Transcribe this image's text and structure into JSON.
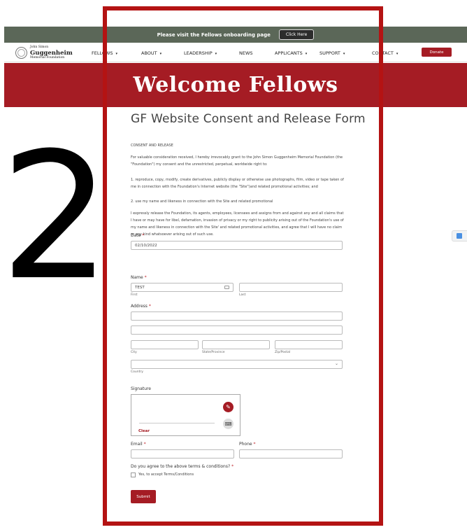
{
  "announcement": {
    "message": "Please visit the Fellows onboarding page",
    "button": "Click Here"
  },
  "logo": {
    "line1": "John Simon",
    "line2": "Guggenheim",
    "line3": "Memorial Foundation"
  },
  "nav": {
    "items": [
      "FELLOWS",
      "ABOUT",
      "LEADERSHIP",
      "NEWS",
      "APPLICANTS",
      "SUPPORT",
      "CONTACT"
    ],
    "chevron": "▾",
    "donate": "Donate"
  },
  "hero": {
    "title": "Welcome Fellows"
  },
  "overlay_number": "2",
  "form": {
    "title": "GF Website Consent and Release Form",
    "section_heading": "CONSENT AND RELEASE",
    "intro": "For valuable consideration received, I hereby irrevocably grant to the John Simon Guggenheim Memorial Foundation (the \"Foundation\") my consent and the unrestricted, perpetual, worldwide right to:",
    "list": [
      "1. reproduce, copy, modify, create derivatives, publicly display or otherwise use photographs, film, video or tape taken of me in connection with the Foundation's Internet website (the \"Site\")and related promotional activities; and",
      "2. use my name and likeness in connection with the Site and related promotional"
    ],
    "release": "I expressly release the Foundation, its agents, employees, licensees and assigns from and against any and all claims that I have or may have for libel, defamation, invasion of privacy or my right to publicity arising out of the Foundation's use of my name and likeness in connection with the Site' and related promotional activities, and agree that I will have no claim or any kind whatsoever arising out of such use.",
    "required_mark": "*",
    "date": {
      "label": "Date",
      "value": "02/10/2022"
    },
    "name": {
      "label": "Name",
      "first_value": "TEST",
      "first_sub": "First",
      "last_value": "",
      "last_sub": "Last"
    },
    "address": {
      "label": "Address",
      "city_sub": "City",
      "state_sub": "State/Province",
      "zip_sub": "Zip/Postal",
      "country_sub": "Country"
    },
    "signature": {
      "label": "Signature",
      "clear": "Clear"
    },
    "email": {
      "label": "Email"
    },
    "phone": {
      "label": "Phone"
    },
    "terms": {
      "question": "Do you agree to the above terms & conditions?",
      "option": "Yes, to accept Terms/Conditions"
    },
    "submit": "Submit"
  },
  "colors": {
    "brand_red": "#a51c24",
    "topbar": "#5b6758",
    "frame": "#b41313"
  }
}
